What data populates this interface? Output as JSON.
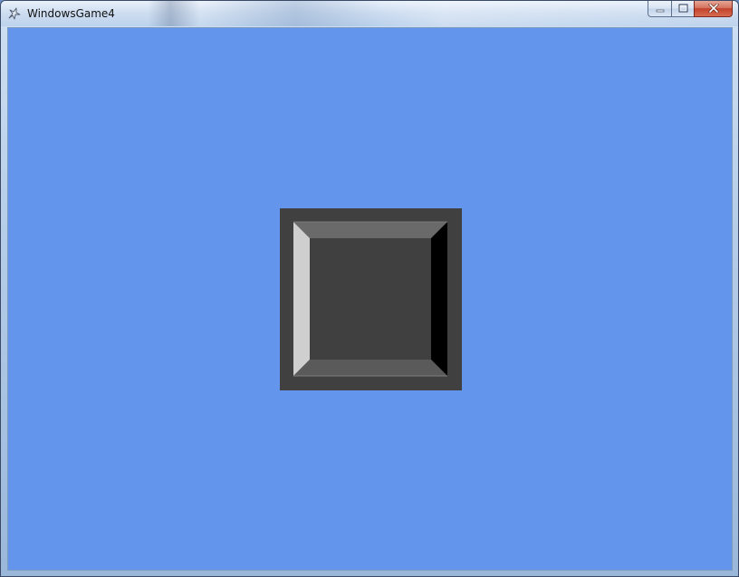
{
  "window": {
    "title": "WindowsGame4",
    "app_icon": "xna-game-icon",
    "controls": {
      "minimize_icon": "minimize-icon",
      "maximize_icon": "maximize-icon",
      "close_icon": "close-icon"
    }
  },
  "game_view": {
    "background_color": "#6495ED",
    "sprite": {
      "name": "beveled-square-tile",
      "outer_color": "#404040",
      "face_color": "#404040",
      "bevel_top_color": "#6a6a6a",
      "bevel_left_color": "#cfcfcf",
      "bevel_right_color": "#000000",
      "bevel_bottom_color": "#5a5a5a"
    }
  }
}
